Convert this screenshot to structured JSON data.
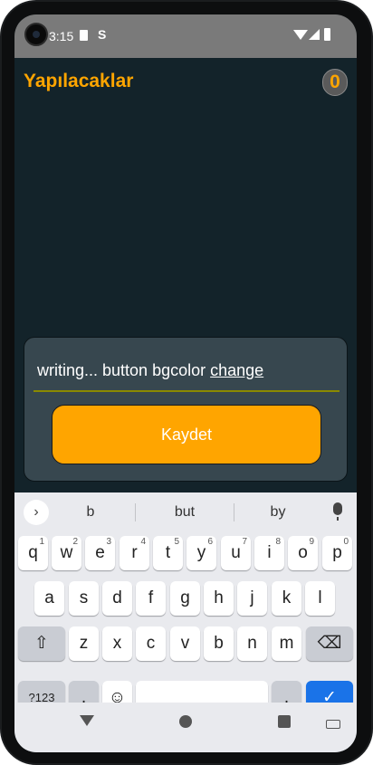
{
  "status_bar": {
    "time": "3:15",
    "s_icon_label": "S",
    "icons": [
      "camera-icon",
      "sim-card-icon",
      "wifi-icon",
      "signal-icon",
      "battery-icon"
    ]
  },
  "app": {
    "title": "Yapılacaklar",
    "count": "0",
    "accent_color": "#ffa500",
    "background_color": "#13232a"
  },
  "input": {
    "value_prefix": "writing... button bgcolor ",
    "value_composing": "change"
  },
  "save_button": {
    "label": "Kaydet"
  },
  "keyboard": {
    "suggestions": [
      "b",
      "but",
      "by"
    ],
    "row1": [
      {
        "key": "q",
        "hint": "1"
      },
      {
        "key": "w",
        "hint": "2"
      },
      {
        "key": "e",
        "hint": "3"
      },
      {
        "key": "r",
        "hint": "4"
      },
      {
        "key": "t",
        "hint": "5"
      },
      {
        "key": "y",
        "hint": "6"
      },
      {
        "key": "u",
        "hint": "7"
      },
      {
        "key": "i",
        "hint": "8"
      },
      {
        "key": "o",
        "hint": "9"
      },
      {
        "key": "p",
        "hint": "0"
      }
    ],
    "row2": [
      "a",
      "s",
      "d",
      "f",
      "g",
      "h",
      "j",
      "k",
      "l"
    ],
    "row3": [
      "z",
      "x",
      "c",
      "v",
      "b",
      "n",
      "m"
    ],
    "symbols_label": "?123",
    "comma_label": ",",
    "period_label": ".",
    "expand_glyph": "›",
    "shift_glyph": "⇧",
    "backspace_glyph": "⌫",
    "emoji_glyph": "☺",
    "enter_glyph": "✓",
    "enter_color": "#1a73e8"
  },
  "nav_bar": {
    "icons": [
      "back-icon",
      "home-icon",
      "recents-icon",
      "keyboard-switch-icon"
    ]
  }
}
